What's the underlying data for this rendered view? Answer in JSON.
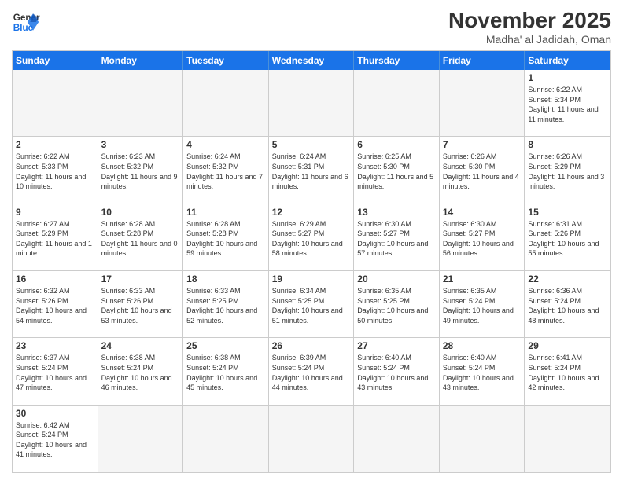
{
  "logo": {
    "general": "General",
    "blue": "Blue"
  },
  "header": {
    "month_year": "November 2025",
    "location": "Madha' al Jadidah, Oman"
  },
  "days_of_week": [
    "Sunday",
    "Monday",
    "Tuesday",
    "Wednesday",
    "Thursday",
    "Friday",
    "Saturday"
  ],
  "weeks": [
    [
      {
        "day": "",
        "empty": true
      },
      {
        "day": "",
        "empty": true
      },
      {
        "day": "",
        "empty": true
      },
      {
        "day": "",
        "empty": true
      },
      {
        "day": "",
        "empty": true
      },
      {
        "day": "",
        "empty": true
      },
      {
        "day": "1",
        "sunrise": "6:22 AM",
        "sunset": "5:34 PM",
        "daylight": "11 hours and 11 minutes."
      }
    ],
    [
      {
        "day": "2",
        "sunrise": "6:22 AM",
        "sunset": "5:33 PM",
        "daylight": "11 hours and 10 minutes."
      },
      {
        "day": "3",
        "sunrise": "6:23 AM",
        "sunset": "5:32 PM",
        "daylight": "11 hours and 9 minutes."
      },
      {
        "day": "4",
        "sunrise": "6:24 AM",
        "sunset": "5:32 PM",
        "daylight": "11 hours and 7 minutes."
      },
      {
        "day": "5",
        "sunrise": "6:24 AM",
        "sunset": "5:31 PM",
        "daylight": "11 hours and 6 minutes."
      },
      {
        "day": "6",
        "sunrise": "6:25 AM",
        "sunset": "5:30 PM",
        "daylight": "11 hours and 5 minutes."
      },
      {
        "day": "7",
        "sunrise": "6:26 AM",
        "sunset": "5:30 PM",
        "daylight": "11 hours and 4 minutes."
      },
      {
        "day": "8",
        "sunrise": "6:26 AM",
        "sunset": "5:29 PM",
        "daylight": "11 hours and 3 minutes."
      }
    ],
    [
      {
        "day": "9",
        "sunrise": "6:27 AM",
        "sunset": "5:29 PM",
        "daylight": "11 hours and 1 minute."
      },
      {
        "day": "10",
        "sunrise": "6:28 AM",
        "sunset": "5:28 PM",
        "daylight": "11 hours and 0 minutes."
      },
      {
        "day": "11",
        "sunrise": "6:28 AM",
        "sunset": "5:28 PM",
        "daylight": "10 hours and 59 minutes."
      },
      {
        "day": "12",
        "sunrise": "6:29 AM",
        "sunset": "5:27 PM",
        "daylight": "10 hours and 58 minutes."
      },
      {
        "day": "13",
        "sunrise": "6:30 AM",
        "sunset": "5:27 PM",
        "daylight": "10 hours and 57 minutes."
      },
      {
        "day": "14",
        "sunrise": "6:30 AM",
        "sunset": "5:27 PM",
        "daylight": "10 hours and 56 minutes."
      },
      {
        "day": "15",
        "sunrise": "6:31 AM",
        "sunset": "5:26 PM",
        "daylight": "10 hours and 55 minutes."
      }
    ],
    [
      {
        "day": "16",
        "sunrise": "6:32 AM",
        "sunset": "5:26 PM",
        "daylight": "10 hours and 54 minutes."
      },
      {
        "day": "17",
        "sunrise": "6:33 AM",
        "sunset": "5:26 PM",
        "daylight": "10 hours and 53 minutes."
      },
      {
        "day": "18",
        "sunrise": "6:33 AM",
        "sunset": "5:25 PM",
        "daylight": "10 hours and 52 minutes."
      },
      {
        "day": "19",
        "sunrise": "6:34 AM",
        "sunset": "5:25 PM",
        "daylight": "10 hours and 51 minutes."
      },
      {
        "day": "20",
        "sunrise": "6:35 AM",
        "sunset": "5:25 PM",
        "daylight": "10 hours and 50 minutes."
      },
      {
        "day": "21",
        "sunrise": "6:35 AM",
        "sunset": "5:24 PM",
        "daylight": "10 hours and 49 minutes."
      },
      {
        "day": "22",
        "sunrise": "6:36 AM",
        "sunset": "5:24 PM",
        "daylight": "10 hours and 48 minutes."
      }
    ],
    [
      {
        "day": "23",
        "sunrise": "6:37 AM",
        "sunset": "5:24 PM",
        "daylight": "10 hours and 47 minutes."
      },
      {
        "day": "24",
        "sunrise": "6:38 AM",
        "sunset": "5:24 PM",
        "daylight": "10 hours and 46 minutes."
      },
      {
        "day": "25",
        "sunrise": "6:38 AM",
        "sunset": "5:24 PM",
        "daylight": "10 hours and 45 minutes."
      },
      {
        "day": "26",
        "sunrise": "6:39 AM",
        "sunset": "5:24 PM",
        "daylight": "10 hours and 44 minutes."
      },
      {
        "day": "27",
        "sunrise": "6:40 AM",
        "sunset": "5:24 PM",
        "daylight": "10 hours and 43 minutes."
      },
      {
        "day": "28",
        "sunrise": "6:40 AM",
        "sunset": "5:24 PM",
        "daylight": "10 hours and 43 minutes."
      },
      {
        "day": "29",
        "sunrise": "6:41 AM",
        "sunset": "5:24 PM",
        "daylight": "10 hours and 42 minutes."
      }
    ],
    [
      {
        "day": "30",
        "sunrise": "6:42 AM",
        "sunset": "5:24 PM",
        "daylight": "10 hours and 41 minutes."
      },
      {
        "day": "",
        "empty": true
      },
      {
        "day": "",
        "empty": true
      },
      {
        "day": "",
        "empty": true
      },
      {
        "day": "",
        "empty": true
      },
      {
        "day": "",
        "empty": true
      },
      {
        "day": "",
        "empty": true
      }
    ]
  ]
}
